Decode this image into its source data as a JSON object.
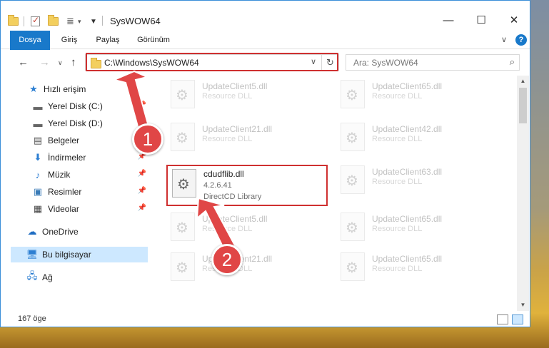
{
  "window": {
    "title": "SysWOW64"
  },
  "titlebar": {
    "minimize": "—",
    "maximize": "☐",
    "close": "✕"
  },
  "ribbon": {
    "tabs": [
      "Dosya",
      "Giriş",
      "Paylaş",
      "Görünüm"
    ],
    "expand": "∨",
    "help": "?"
  },
  "nav": {
    "back": "←",
    "forward": "→",
    "recent": "∨",
    "up": "↑",
    "address": "C:\\Windows\\SysWOW64",
    "address_dropdown": "∨",
    "refresh": "↻",
    "search_placeholder": "Ara: SysWOW64",
    "search_icon": "⌕"
  },
  "sidebar": {
    "items": [
      {
        "label": "Hızlı erişim",
        "icon": "star-icon"
      },
      {
        "label": "Yerel Disk (C:)",
        "icon": "drive-icon"
      },
      {
        "label": "Yerel Disk (D:)",
        "icon": "drive-icon"
      },
      {
        "label": "Belgeler",
        "icon": "documents-icon"
      },
      {
        "label": "İndirmeler",
        "icon": "download-icon"
      },
      {
        "label": "Müzik",
        "icon": "music-icon"
      },
      {
        "label": "Resimler",
        "icon": "pictures-icon"
      },
      {
        "label": "Videolar",
        "icon": "videos-icon"
      },
      {
        "label": "OneDrive",
        "icon": "cloud-icon"
      },
      {
        "label": "Bu bilgisayar",
        "icon": "computer-icon"
      },
      {
        "label": "Ağ",
        "icon": "network-icon"
      }
    ]
  },
  "files": {
    "left": [
      {
        "name": "UpdateClient5.dll",
        "type": "Resource DLL"
      },
      {
        "name": "UpdateClient21.dll",
        "type": "Resource DLL"
      },
      {
        "name": "UpdateClient5.dll",
        "type": "Resource DLL"
      },
      {
        "name": "UpdateClient21.dll",
        "type": "Resource DLL"
      }
    ],
    "right": [
      {
        "name": "UpdateClient65.dll",
        "type": "Resource DLL"
      },
      {
        "name": "UpdateClient42.dll",
        "type": "Resource DLL"
      },
      {
        "name": "UpdateClient63.dll",
        "type": "Resource DLL"
      },
      {
        "name": "UpdateClient65.dll",
        "type": "Resource DLL"
      },
      {
        "name": "UpdateClient65.dll",
        "type": "Resource DLL"
      }
    ],
    "highlighted": {
      "name": "cdudflib.dll",
      "version": "4.2.6.41",
      "description": "DirectCD Library"
    }
  },
  "status": {
    "item_count": "167 öge"
  },
  "annotations": {
    "step1": "1",
    "step2": "2",
    "color": "#e04646"
  }
}
